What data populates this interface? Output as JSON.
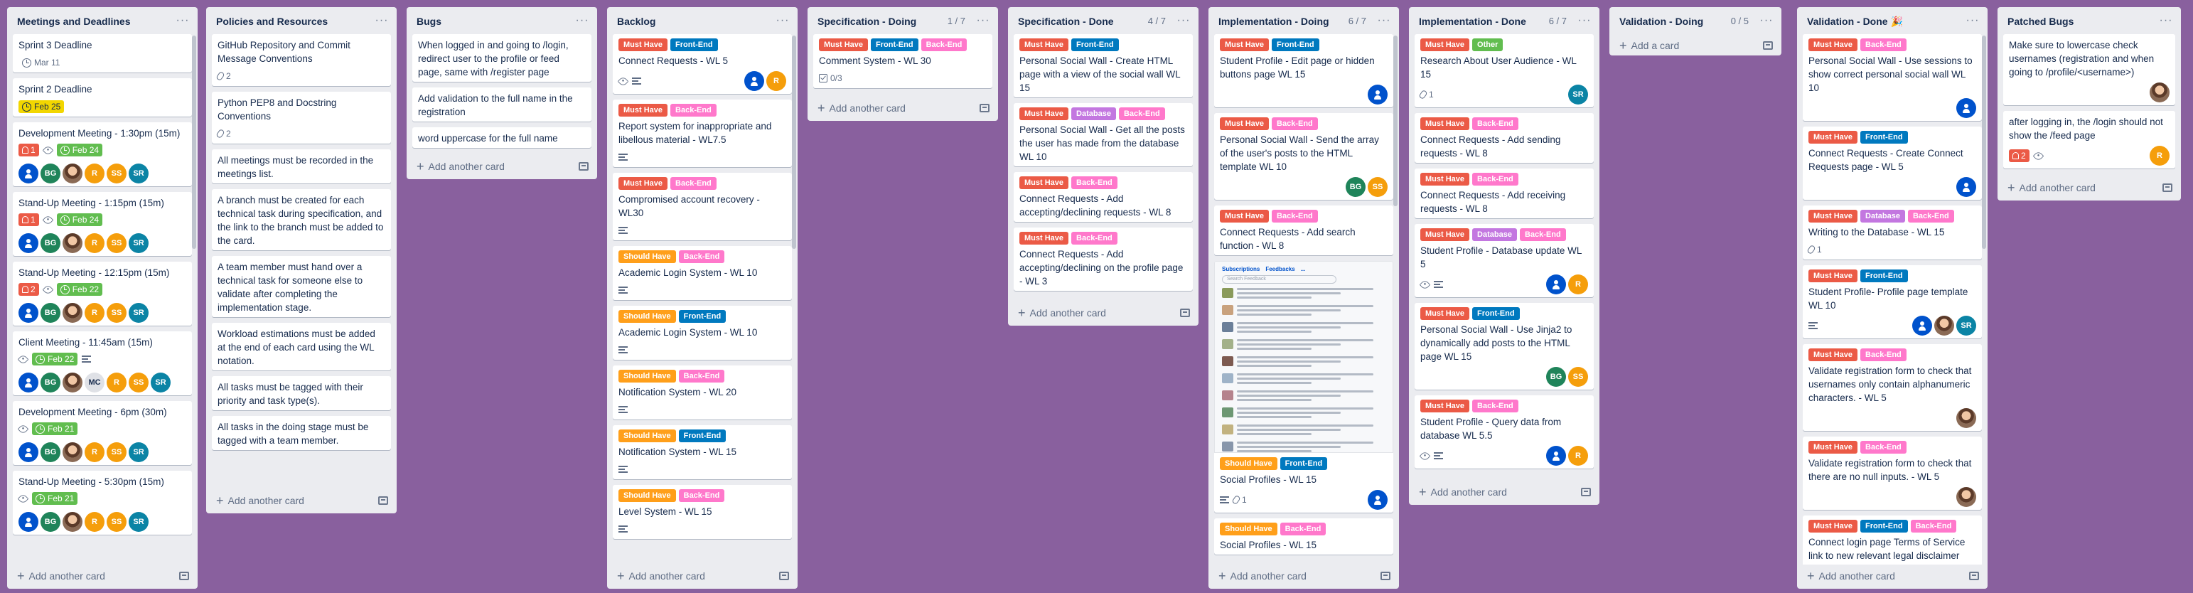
{
  "colors": {
    "board_bg": "#89609e",
    "must_have": "#eb5a46",
    "front_end": "#0079bf",
    "back_end": "#ff78cb",
    "should_have": "#ff9f1a",
    "database": "#c377e0",
    "other": "#61bd4f"
  },
  "common": {
    "add_card": "Add another card",
    "add_a_card": "Add a card"
  },
  "lists": [
    {
      "title": "Meetings and Deadlines",
      "count": "",
      "cards": [
        {
          "title": "Sprint 3 Deadline",
          "due": {
            "style": "plain",
            "text": "Mar 11"
          }
        },
        {
          "title": "Sprint 2 Deadline",
          "due": {
            "style": "yellow",
            "text": "Feb 25"
          }
        },
        {
          "title": "Development Meeting - 1:30pm (15m)",
          "alert": "1",
          "watch": true,
          "due": {
            "style": "green",
            "text": "Feb 24"
          },
          "members_full": true,
          "members": [
            {
              "t": "",
              "c": "blue"
            },
            {
              "t": "BG",
              "c": "green"
            },
            {
              "t": "",
              "c": "photo"
            },
            {
              "t": "R",
              "c": "orange"
            },
            {
              "t": "SS",
              "c": "orange"
            },
            {
              "t": "SR",
              "c": "teal"
            }
          ]
        },
        {
          "title": "Stand-Up Meeting - 1:15pm (15m)",
          "alert": "1",
          "watch": true,
          "due": {
            "style": "green",
            "text": "Feb 24"
          },
          "members_full": true,
          "members": [
            {
              "t": "",
              "c": "blue"
            },
            {
              "t": "BG",
              "c": "green"
            },
            {
              "t": "",
              "c": "photo"
            },
            {
              "t": "R",
              "c": "orange"
            },
            {
              "t": "SS",
              "c": "orange"
            },
            {
              "t": "SR",
              "c": "teal"
            }
          ]
        },
        {
          "title": "Stand-Up Meeting - 12:15pm (15m)",
          "alert": "2",
          "watch": true,
          "due": {
            "style": "green",
            "text": "Feb 22"
          },
          "members_full": true,
          "members": [
            {
              "t": "",
              "c": "blue"
            },
            {
              "t": "BG",
              "c": "green"
            },
            {
              "t": "",
              "c": "photo"
            },
            {
              "t": "R",
              "c": "orange"
            },
            {
              "t": "SS",
              "c": "orange"
            },
            {
              "t": "SR",
              "c": "teal"
            }
          ]
        },
        {
          "title": "Client Meeting - 11:45am (15m)",
          "watch": true,
          "due": {
            "style": "green",
            "text": "Feb 22"
          },
          "desc": true,
          "members_full": true,
          "members": [
            {
              "t": "",
              "c": "blue"
            },
            {
              "t": "BG",
              "c": "green"
            },
            {
              "t": "",
              "c": "photo"
            },
            {
              "t": "MC",
              "c": "grey"
            },
            {
              "t": "R",
              "c": "orange"
            },
            {
              "t": "SS",
              "c": "orange"
            },
            {
              "t": "SR",
              "c": "teal"
            }
          ]
        },
        {
          "title": "Development Meeting - 6pm (30m)",
          "watch": true,
          "due": {
            "style": "green",
            "text": "Feb 21"
          },
          "members_full": true,
          "members": [
            {
              "t": "",
              "c": "blue"
            },
            {
              "t": "BG",
              "c": "green"
            },
            {
              "t": "",
              "c": "photo"
            },
            {
              "t": "R",
              "c": "orange"
            },
            {
              "t": "SS",
              "c": "orange"
            },
            {
              "t": "SR",
              "c": "teal"
            }
          ]
        },
        {
          "title": "Stand-Up Meeting - 5:30pm (15m)",
          "watch": true,
          "due": {
            "style": "green",
            "text": "Feb 21"
          },
          "members_full": true,
          "members": [
            {
              "t": "",
              "c": "blue"
            },
            {
              "t": "BG",
              "c": "green"
            },
            {
              "t": "",
              "c": "photo"
            },
            {
              "t": "R",
              "c": "orange"
            },
            {
              "t": "SS",
              "c": "orange"
            },
            {
              "t": "SR",
              "c": "teal"
            }
          ]
        }
      ]
    },
    {
      "title": "Policies and Resources",
      "count": "",
      "cards": [
        {
          "title": "GitHub Repository and Commit Message Conventions",
          "attach": "2"
        },
        {
          "title": "Python PEP8 and Docstring Conventions",
          "attach": "2"
        },
        {
          "title": "All meetings must be recorded in the meetings list."
        },
        {
          "title": "A branch must be created for each technical task during specification, and the link to the branch must be added to the card."
        },
        {
          "title": "A team member must hand over a technical task for someone else to validate after completing the implementation stage."
        },
        {
          "title": "Workload estimations must be added at the end of each card using the WL notation."
        },
        {
          "title": "All tasks must be tagged with their priority and task type(s)."
        },
        {
          "title": "All tasks in the doing stage must be tagged with a team member."
        }
      ]
    },
    {
      "title": "Bugs",
      "count": "",
      "cards": [
        {
          "title": "When logged in and going to /login, redirect user to the profile or feed page, same with /register page"
        },
        {
          "title": "Add validation to the full name in the registration"
        },
        {
          "title": "word uppercase for the full name"
        }
      ]
    },
    {
      "title": "Backlog",
      "count": "",
      "cards": [
        {
          "labels": [
            "must_have",
            "front_end"
          ],
          "title": "Connect Requests - WL 5",
          "watch": true,
          "desc": true,
          "members": [
            {
              "t": "",
              "c": "blue"
            },
            {
              "t": "R",
              "c": "orange"
            }
          ]
        },
        {
          "labels": [
            "must_have",
            "back_end"
          ],
          "title": "Report system for inappropriate and libellous material - WL7.5",
          "desc": true
        },
        {
          "labels": [
            "must_have",
            "back_end"
          ],
          "title": "Compromised account recovery - WL30",
          "desc": true
        },
        {
          "labels": [
            "should_have",
            "back_end"
          ],
          "title": "Academic Login System - WL 10",
          "desc": true
        },
        {
          "labels": [
            "should_have",
            "front_end"
          ],
          "title": "Academic Login System - WL 10",
          "desc": true
        },
        {
          "labels": [
            "should_have",
            "back_end"
          ],
          "title": "Notification System - WL 20",
          "desc": true
        },
        {
          "labels": [
            "should_have",
            "front_end"
          ],
          "title": "Notification System - WL 15",
          "desc": true
        },
        {
          "labels": [
            "should_have",
            "back_end"
          ],
          "title": "Level System - WL 15",
          "desc": true
        }
      ]
    },
    {
      "title": "Specification - Doing",
      "count": "1 / 7",
      "cards": [
        {
          "labels": [
            "must_have",
            "front_end",
            "back_end"
          ],
          "title": "Comment System - WL 30",
          "check": "0/3"
        }
      ]
    },
    {
      "title": "Specification - Done",
      "count": "4 / 7",
      "cards": [
        {
          "labels": [
            "must_have",
            "front_end"
          ],
          "title": "Personal Social Wall - Create HTML page with a view of the social wall WL 15"
        },
        {
          "labels": [
            "must_have",
            "database",
            "back_end"
          ],
          "title": "Personal Social Wall - Get all the posts the user has made from the database WL 10"
        },
        {
          "labels": [
            "must_have",
            "back_end"
          ],
          "title": "Connect Requests - Add accepting/declining requests - WL 8"
        },
        {
          "labels": [
            "must_have",
            "back_end"
          ],
          "title": "Connect Requests - Add accepting/declining on the profile page - WL 3"
        }
      ]
    },
    {
      "title": "Implementation - Doing",
      "count": "6 / 7",
      "cards": [
        {
          "labels": [
            "must_have",
            "front_end"
          ],
          "title": "Student Profile - Edit page or hidden buttons page WL 15",
          "members": [
            {
              "t": "",
              "c": "blue"
            }
          ]
        },
        {
          "labels": [
            "must_have",
            "back_end"
          ],
          "title": "Personal Social Wall - Send the array of the user's posts to the HTML template WL 10",
          "members": [
            {
              "t": "BG",
              "c": "green"
            },
            {
              "t": "SS",
              "c": "orange"
            }
          ]
        },
        {
          "labels": [
            "must_have",
            "back_end"
          ],
          "title": "Connect Requests - Add search function - WL 8"
        },
        {
          "cover": true,
          "cover_tabs": [
            "Subscriptions",
            "Feedbacks",
            "..."
          ],
          "cover_search": "Search Feedback",
          "labels": [
            "should_have",
            "front_end"
          ],
          "title": "Social Profiles - WL 15",
          "desc": true,
          "attach": "1",
          "members": [
            {
              "t": "",
              "c": "blue"
            }
          ]
        },
        {
          "labels": [
            "should_have",
            "back_end"
          ],
          "title": "Social Profiles - WL 15"
        }
      ]
    },
    {
      "title": "Implementation - Done",
      "count": "6 / 7",
      "cards": [
        {
          "labels": [
            "must_have",
            "other"
          ],
          "title": "Research About User Audience - WL 15",
          "attach": "1",
          "members": [
            {
              "t": "SR",
              "c": "teal"
            }
          ]
        },
        {
          "labels": [
            "must_have",
            "back_end"
          ],
          "title": "Connect Requests - Add sending requests - WL 8"
        },
        {
          "labels": [
            "must_have",
            "back_end"
          ],
          "title": "Connect Requests - Add receiving requests - WL 8"
        },
        {
          "labels": [
            "must_have",
            "database",
            "back_end"
          ],
          "title": "Student Profile - Database update WL 5",
          "watch": true,
          "desc": true,
          "members": [
            {
              "t": "",
              "c": "blue"
            },
            {
              "t": "R",
              "c": "orange"
            }
          ]
        },
        {
          "labels": [
            "must_have",
            "front_end"
          ],
          "title": "Personal Social Wall - Use Jinja2 to dynamically add posts to the HTML page WL 15",
          "members": [
            {
              "t": "BG",
              "c": "green"
            },
            {
              "t": "SS",
              "c": "orange"
            }
          ]
        },
        {
          "labels": [
            "must_have",
            "back_end"
          ],
          "title": "Student Profile - Query data from database WL 5.5",
          "watch": true,
          "desc": true,
          "members": [
            {
              "t": "",
              "c": "blue"
            },
            {
              "t": "R",
              "c": "orange"
            }
          ]
        }
      ]
    },
    {
      "title": "Validation - Doing",
      "count": "0 / 5",
      "add_style": "short",
      "cards": []
    },
    {
      "title": "Validation - Done 🎉",
      "count": "",
      "cards": [
        {
          "labels": [
            "must_have",
            "back_end"
          ],
          "title": "Personal Social Wall - Use sessions to show correct personal social wall WL 10",
          "members": [
            {
              "t": "",
              "c": "blue"
            }
          ]
        },
        {
          "labels": [
            "must_have",
            "front_end"
          ],
          "title": "Connect Requests - Create Connect Requests page - WL 5",
          "members": [
            {
              "t": "",
              "c": "blue"
            }
          ]
        },
        {
          "labels": [
            "must_have",
            "database",
            "back_end"
          ],
          "title": "Writing to the Database - WL 15",
          "attach": "1"
        },
        {
          "labels": [
            "must_have",
            "front_end"
          ],
          "title": "Student Profile- Profile page template WL 10",
          "desc": true,
          "members": [
            {
              "t": "",
              "c": "blue"
            },
            {
              "t": "",
              "c": "photo"
            },
            {
              "t": "SR",
              "c": "teal"
            }
          ]
        },
        {
          "labels": [
            "must_have",
            "back_end"
          ],
          "title": "Validate registration form to check that usernames only contain alphanumeric characters. - WL 5",
          "members": [
            {
              "t": "",
              "c": "photo"
            }
          ]
        },
        {
          "labels": [
            "must_have",
            "back_end"
          ],
          "title": "Validate registration form to check that there are no null inputs. - WL 5",
          "members": [
            {
              "t": "",
              "c": "photo"
            }
          ]
        },
        {
          "labels": [
            "must_have",
            "front_end",
            "back_end"
          ],
          "title": "Connect login page Terms of Service link to new relevant legal disclaimer page"
        }
      ]
    },
    {
      "title": "Patched Bugs",
      "count": "",
      "cards": [
        {
          "title": "Make sure to lowercase check usernames (registration and when going to /profile/<username>)",
          "members": [
            {
              "t": "",
              "c": "photo"
            }
          ]
        },
        {
          "title": "after logging in, the /login should not show the /feed page",
          "alert": "2",
          "watch": true,
          "members": [
            {
              "t": "R",
              "c": "orange"
            }
          ]
        }
      ]
    }
  ],
  "label_names": {
    "must_have": "Must Have",
    "front_end": "Front-End",
    "back_end": "Back-End",
    "should_have": "Should Have",
    "database": "Database",
    "other": "Other"
  }
}
